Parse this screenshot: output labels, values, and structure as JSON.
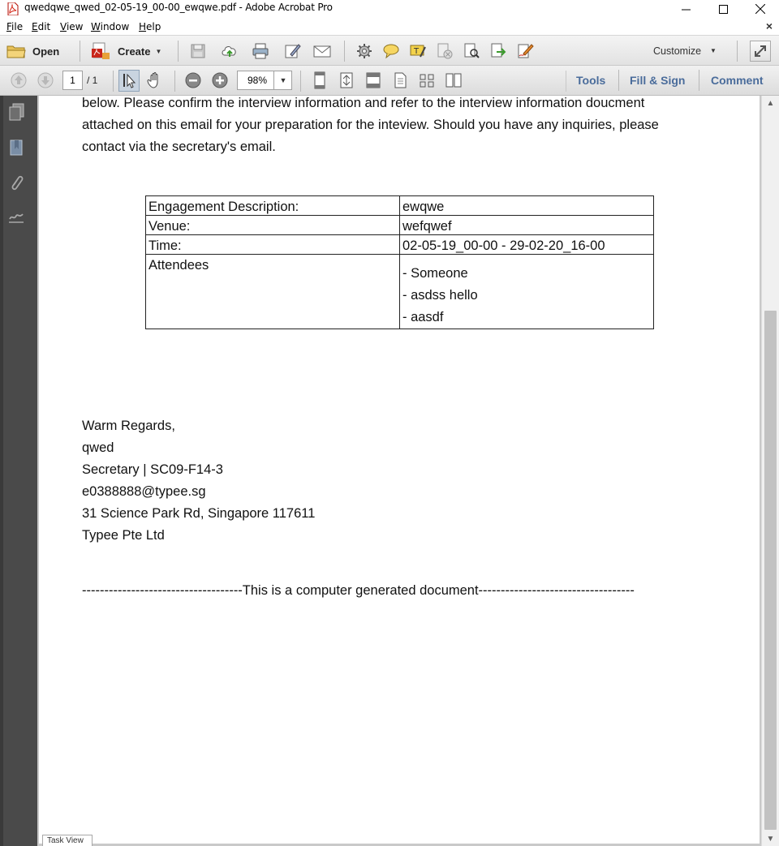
{
  "window": {
    "title": "qwedqwe_qwed_02-05-19_00-00_ewqwe.pdf - Adobe Acrobat Pro"
  },
  "menu": [
    "File",
    "Edit",
    "View",
    "Window",
    "Help"
  ],
  "toolbar": {
    "open_label": "Open",
    "create_label": "Create",
    "customize_label": "Customize"
  },
  "nav": {
    "page_current": "1",
    "page_total": "/ 1",
    "zoom": "98%"
  },
  "panels": {
    "tools": "Tools",
    "fill_sign": "Fill & Sign",
    "comment": "Comment"
  },
  "document": {
    "intro_lines": [
      "below. Please confirm the interview information and refer to the interview information doucment",
      "attached on this email for your preparation for the inteview. Should you have any inquiries, please",
      "contact via the secretary's email."
    ],
    "table": {
      "rows": [
        {
          "label": "Engagement Description:",
          "value": "ewqwe"
        },
        {
          "label": "Venue:",
          "value": "wefqwef"
        },
        {
          "label": "Time:",
          "value": "02-05-19_00-00 - 29-02-20_16-00"
        }
      ],
      "attendees_label": "Attendees",
      "attendees": [
        "- Someone",
        "- asdss hello",
        "- aasdf"
      ]
    },
    "signature": [
      "Warm Regards,",
      "qwed",
      "Secretary | SC09-F14-3",
      "e0388888@typee.sg",
      "31 Science Park Rd, Singapore 117611",
      "Typee Pte Ltd"
    ],
    "footer": "------------------------------------This is a computer generated document-----------------------------------"
  },
  "status": {
    "task_view": "Task View"
  }
}
